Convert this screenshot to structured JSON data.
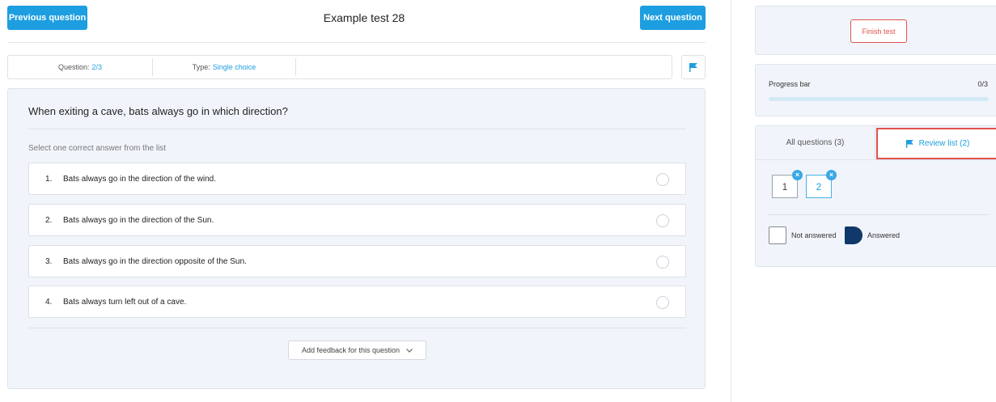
{
  "header": {
    "prev_label": "Previous question",
    "title": "Example test 28",
    "next_label": "Next question"
  },
  "info": {
    "question_label": "Question:",
    "question_value": "2/3",
    "type_label": "Type:",
    "type_value": "Single choice",
    "flag_icon": "flag-icon"
  },
  "question": {
    "text": "When exiting a cave, bats always go in which direction?",
    "instruction": "Select one correct answer from the list",
    "answers": [
      {
        "num": "1.",
        "text": "Bats always go in the direction of the wind."
      },
      {
        "num": "2.",
        "text": "Bats always go in the direction of the Sun."
      },
      {
        "num": "3.",
        "text": "Bats always go in the direction opposite of the Sun."
      },
      {
        "num": "4.",
        "text": "Bats always turn left out of a cave."
      }
    ],
    "feedback_label": "Add feedback for this question"
  },
  "sidebar": {
    "finish_label": "Finish test",
    "progress_label": "Progress bar",
    "progress_count": "0/3",
    "progress_fraction": 0,
    "tabs": {
      "all_label": "All questions (3)",
      "review_label": "Review list (2)"
    },
    "review_items": [
      "1",
      "2"
    ],
    "legend": {
      "not_answered": "Not answered",
      "answered": "Answered"
    }
  },
  "colors": {
    "accent": "#1d9ee0",
    "danger": "#e0524a",
    "answered": "#10386a",
    "panel_bg": "#f1f5fb"
  }
}
